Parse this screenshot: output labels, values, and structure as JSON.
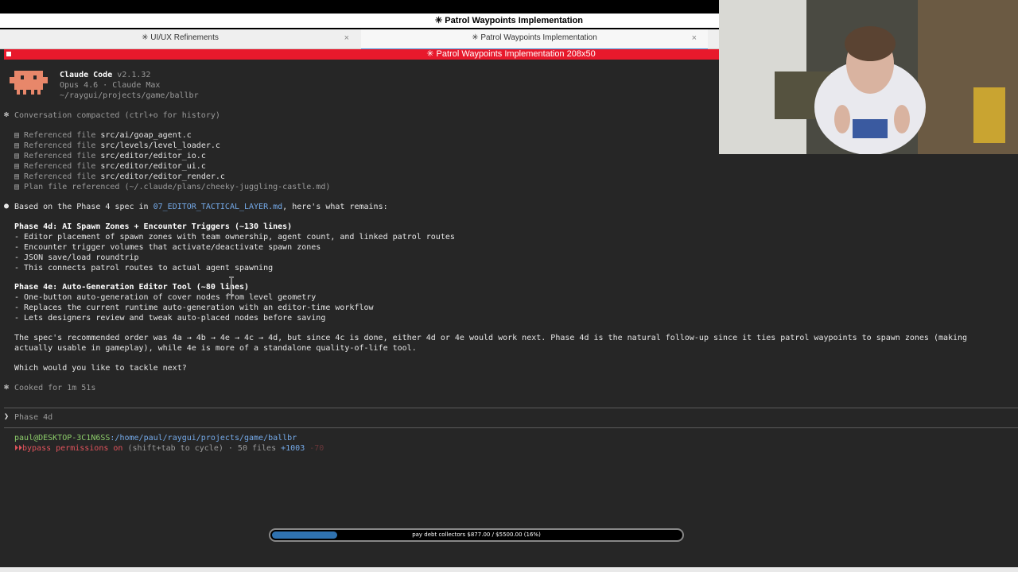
{
  "window": {
    "title": "✳ Patrol Waypoints Implementation"
  },
  "tabs": [
    {
      "label": "✳ UI/UX Refinements",
      "close": "×"
    },
    {
      "label": "✳ Patrol Waypoints Implementation",
      "close": "×"
    }
  ],
  "statusbar": {
    "text": "✳ Patrol Waypoints Implementation 208x50"
  },
  "header": {
    "app_name": "Claude Code",
    "version": "v2.1.32",
    "model": "Opus 4.6 · Claude Max",
    "path": "~/raygui/projects/game/ballbr"
  },
  "compacted": "Conversation compacted (ctrl+o for history)",
  "referenced_prefix": "Referenced file",
  "referenced_files": [
    "src/ai/goap_agent.c",
    "src/levels/level_loader.c",
    "src/editor/editor_io.c",
    "src/editor/editor_ui.c",
    "src/editor/editor_render.c"
  ],
  "plan_ref": "Plan file referenced (~/.claude/plans/cheeky-juggling-castle.md)",
  "response": {
    "intro_before": "Based on the Phase 4 spec in ",
    "intro_file": "07_EDITOR_TACTICAL_LAYER.md",
    "intro_after": ", here's what remains:",
    "phase4d_title": "Phase 4d: AI Spawn Zones + Encounter Triggers (~130 lines)",
    "phase4d_items": [
      "- Editor placement of spawn zones with team ownership, agent count, and linked patrol routes",
      "- Encounter trigger volumes that activate/deactivate spawn zones",
      "- JSON save/load roundtrip",
      "- This connects patrol routes to actual agent spawning"
    ],
    "phase4e_title": "Phase 4e: Auto-Generation Editor Tool (~80 lines)",
    "phase4e_items": [
      "- One-button auto-generation of cover nodes from level geometry",
      "- Replaces the current runtime auto-generation with an editor-time workflow",
      "- Lets designers review and tweak auto-placed nodes before saving"
    ],
    "para_line1": "The spec's recommended order was 4a → 4b → 4e → 4c → 4d, but since 4c is done, either 4d or 4e would work next. Phase 4d is the natural follow-up since it ties patrol waypoints to spawn zones (making",
    "para_line2": "actually usable in gameplay), while 4e is more of a standalone quality-of-life tool.",
    "question": "Which would you like to tackle next?"
  },
  "cooked": "Cooked for 1m 51s",
  "prompt": {
    "symbol": "❯",
    "placeholder": "Phase 4d"
  },
  "shell": {
    "user_host": "paul@DESKTOP-3C1N6SS",
    "cwd": ":/home/paul/raygui/projects/game/ballbr",
    "perm_icon": "⏵⏵",
    "perm_text": "bypass permissions on",
    "perm_hint": " (shift+tab to cycle) · 50 files ",
    "added": "+1003",
    "removed": "-70"
  },
  "progress": {
    "label": "pay debt collectors $877.00 / $5500.00 (16%)",
    "fraction": 0.16
  },
  "colors": {
    "statusbar": "#e8192c",
    "accent_blue": "#74a9e8",
    "shell_green": "#8ccc6a",
    "perm_red": "#e0535c",
    "progress_fill": "#2f72b0",
    "mascot": "#e8876a"
  }
}
